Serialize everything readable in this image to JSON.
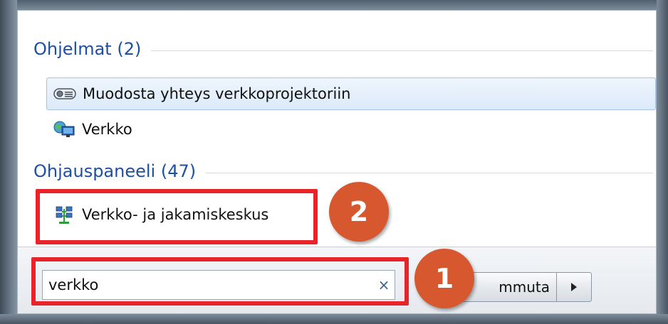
{
  "groups": {
    "programs": {
      "title": "Ohjelmat (2)",
      "items": [
        {
          "label": "Muodosta yhteys verkkoprojektoriin",
          "icon": "projector-icon",
          "selected": true
        },
        {
          "label": "Verkko",
          "icon": "network-globe-icon",
          "selected": false
        }
      ]
    },
    "control_panel": {
      "title": "Ohjauspaneeli (47)",
      "items": [
        {
          "label": "Verkko- ja jakamiskeskus",
          "icon": "network-sharing-center-icon",
          "selected": false
        }
      ]
    }
  },
  "search": {
    "value": "verkko",
    "clear_symbol": "×"
  },
  "shutdown": {
    "label": "mmuta"
  },
  "callouts": {
    "step1": "1",
    "step2": "2"
  },
  "colors": {
    "callout_border": "#e8232a",
    "callout_badge": "#d7572f",
    "group_title": "#1f4fa0",
    "selection": "#dceaf9"
  }
}
